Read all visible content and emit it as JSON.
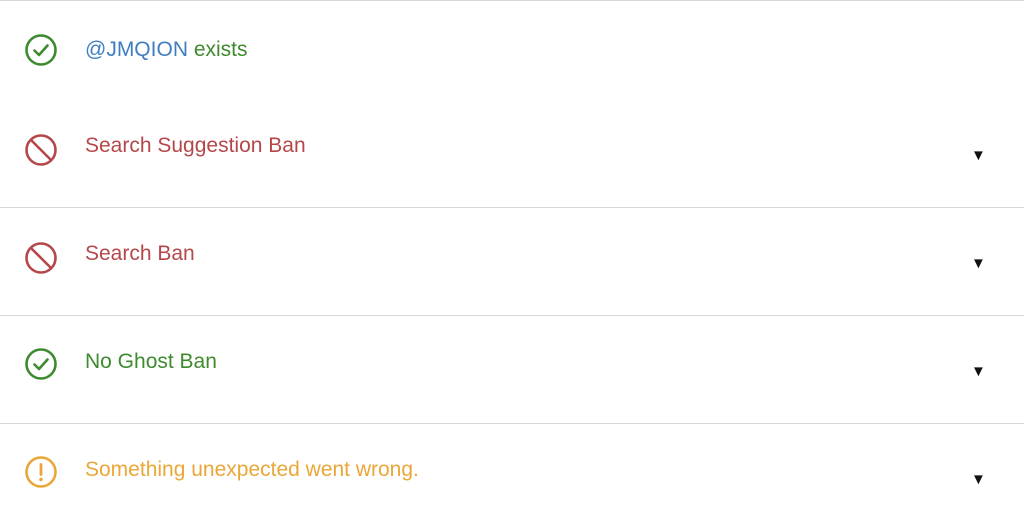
{
  "existence": {
    "handle": "@JMQION",
    "status_text": "exists",
    "icon": "check-circle-icon",
    "color": "#3e8a2e"
  },
  "checks": [
    {
      "label": "Search Suggestion Ban",
      "status": "banned",
      "icon": "ban-icon",
      "color": "#b5474a",
      "toggle": "▼"
    },
    {
      "label": "Search Ban",
      "status": "banned",
      "icon": "ban-icon",
      "color": "#b5474a",
      "toggle": "▼"
    },
    {
      "label": "No Ghost Ban",
      "status": "ok",
      "icon": "check-circle-icon",
      "color": "#3e8a2e",
      "toggle": "▼"
    },
    {
      "label": "Something unexpected went wrong.",
      "status": "warning",
      "icon": "exclamation-circle-icon",
      "color": "#eaa737",
      "toggle": "▼"
    }
  ]
}
